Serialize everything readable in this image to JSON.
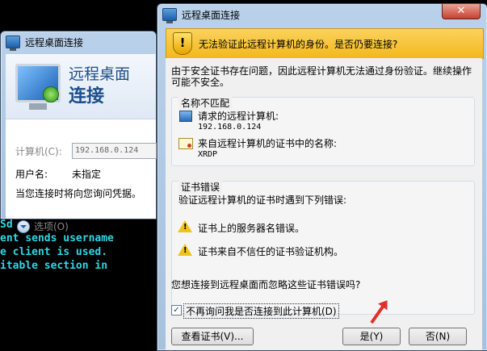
{
  "terminal": {
    "lines": [
      "Sd",
      "",
      "ent sends username",
      "e client is used.",
      "itable section in"
    ]
  },
  "back_window": {
    "title": "远程桌面连接",
    "banner_line1": "远程桌面",
    "banner_line2": "连接",
    "computer_label": "计算机(C):",
    "computer_value": "192.168.0.124",
    "user_label": "用户名:",
    "user_value": "未指定",
    "credential_note": "当您连接时将向您询问凭据。",
    "options_label": "选项(O)"
  },
  "dialog": {
    "title": "远程桌面连接",
    "close_label": "✕",
    "warning_text": "无法验证此远程计算机的身份。是否仍要连接?",
    "intro": "由于安全证书存在问题，因此远程计算机无法通过身份验证。继续操作可能不安全。",
    "name_group": {
      "title": "名称不匹配",
      "requested_label": "请求的远程计算机:",
      "requested_value": "192.168.0.124",
      "cert_label": "来自远程计算机的证书中的名称:",
      "cert_value": "XRDP"
    },
    "cert_group": {
      "title": "证书错误",
      "description": "验证远程计算机的证书时遇到下列错误:",
      "errors": [
        "证书上的服务器名错误。",
        "证书来自不信任的证书验证机构。"
      ]
    },
    "question": "您想连接到远程桌面而忽略这些证书错误吗?",
    "checkbox_label": "不再询问我是否连接到此计算机(D)",
    "checkbox_checked": true,
    "view_cert_button": "查看证书(V)...",
    "yes_button": "是(Y)",
    "no_button": "否(N)"
  },
  "colors": {
    "terminal_text": "#2fd8e6",
    "warning_banner": "#f3b81d",
    "arrow": "#e0302a"
  }
}
